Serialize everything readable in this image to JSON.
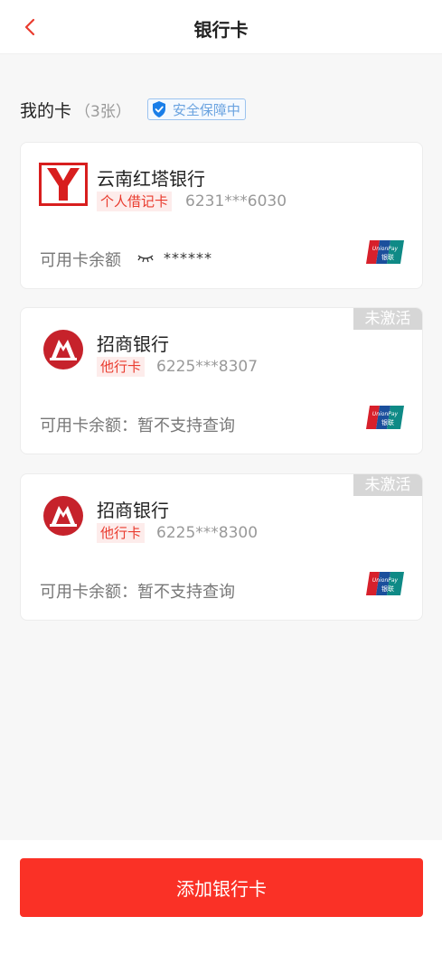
{
  "header": {
    "title": "银行卡"
  },
  "section": {
    "title": "我的卡",
    "count": "（3张）",
    "security_badge": "安全保障中"
  },
  "cards": [
    {
      "bank": "云南红塔银行",
      "type_tag": "个人借记卡",
      "number": "6231***6030",
      "balance_label": "可用卡余额",
      "balance_masked": "******",
      "logo_icon": "hongta-bank-logo",
      "brand_icon": "unionpay-icon",
      "status": ""
    },
    {
      "bank": "招商银行",
      "type_tag": "他行卡",
      "number": "6225***8307",
      "balance_label": "可用卡余额：暂不支持查询",
      "logo_icon": "cmb-bank-logo",
      "brand_icon": "unionpay-icon",
      "status": "未激活"
    },
    {
      "bank": "招商银行",
      "type_tag": "他行卡",
      "number": "6225***8300",
      "balance_label": "可用卡余额：暂不支持查询",
      "logo_icon": "cmb-bank-logo",
      "brand_icon": "unionpay-icon",
      "status": "未激活"
    }
  ],
  "actions": {
    "add_card": "添加银行卡"
  },
  "colors": {
    "accent": "#fa3126",
    "tag_bg": "#fdeceb",
    "tag_text": "#e93b2e",
    "security_blue": "#1a7ee8"
  }
}
